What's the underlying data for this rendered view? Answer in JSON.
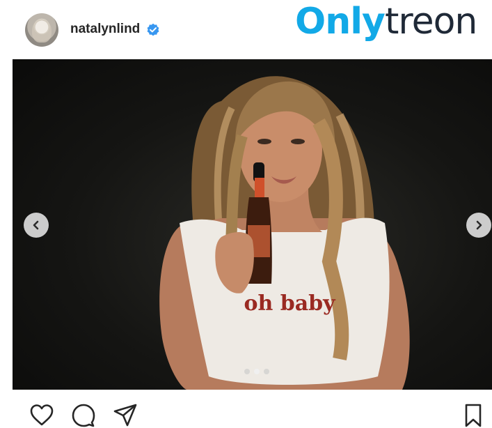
{
  "post": {
    "username": "natalynlind",
    "verified": true,
    "avatar": "profile-avatar"
  },
  "brand": {
    "part1": "Only",
    "part2": "treon",
    "color_primary": "#12a9e7",
    "color_secondary": "#1f2937"
  },
  "media": {
    "shirt_text": "oh baby",
    "slide_index": 2,
    "slide_count": 3,
    "icons": {
      "prev": "chevron-left-icon",
      "next": "chevron-right-icon"
    }
  },
  "actions": {
    "icons": [
      "heart-icon",
      "comment-icon",
      "share-icon",
      "bookmark-icon"
    ]
  },
  "colors": {
    "verified_badge": "#3897f0",
    "text": "#262626"
  }
}
